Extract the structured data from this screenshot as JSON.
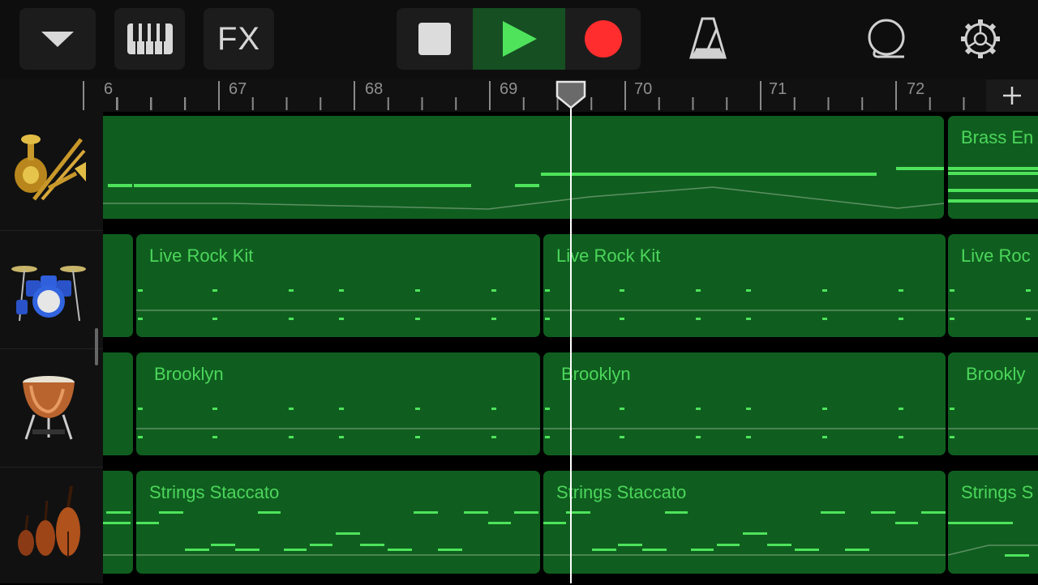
{
  "toolbar": {
    "browser_button": {
      "icon": "chevron-down-icon"
    },
    "keyboard_button": {
      "icon": "piano-keys-icon"
    },
    "fx_button": {
      "label": "FX"
    },
    "transport": {
      "stop": {
        "icon": "stop-icon"
      },
      "play": {
        "icon": "play-icon",
        "active": true
      },
      "record": {
        "icon": "record-icon"
      }
    },
    "metronome_button": {
      "icon": "metronome-icon"
    },
    "loop_button": {
      "icon": "loop-browser-icon"
    },
    "settings_button": {
      "icon": "gear-icon"
    }
  },
  "ruler": {
    "bars": [
      "6",
      "67",
      "68",
      "69",
      "70",
      "71",
      "72"
    ],
    "add_button_icon": "plus-icon",
    "playhead_position_bar": 69.6
  },
  "tracks": [
    {
      "instrument_icon": "brass-icon",
      "regions": [
        {
          "name": ""
        },
        {
          "name": "Brass En"
        }
      ]
    },
    {
      "instrument_icon": "drum-kit-icon",
      "regions": [
        {
          "name": ""
        },
        {
          "name": "Live Rock Kit"
        },
        {
          "name": "Live Rock Kit"
        },
        {
          "name": "Live Roc"
        }
      ]
    },
    {
      "instrument_icon": "timpani-icon",
      "regions": [
        {
          "name": ""
        },
        {
          "name": "Brooklyn"
        },
        {
          "name": "Brooklyn"
        },
        {
          "name": "Brookly"
        }
      ]
    },
    {
      "instrument_icon": "strings-icon",
      "regions": [
        {
          "name": ""
        },
        {
          "name": "Strings Staccato"
        },
        {
          "name": "Strings Staccato"
        },
        {
          "name": "Strings S"
        }
      ]
    }
  ],
  "colors": {
    "region_fill": "#0f5e1f",
    "region_text": "#4cd65b",
    "play_active_bg": "#164f22",
    "record": "#ff2d2d",
    "playhead": "#ffffff"
  }
}
